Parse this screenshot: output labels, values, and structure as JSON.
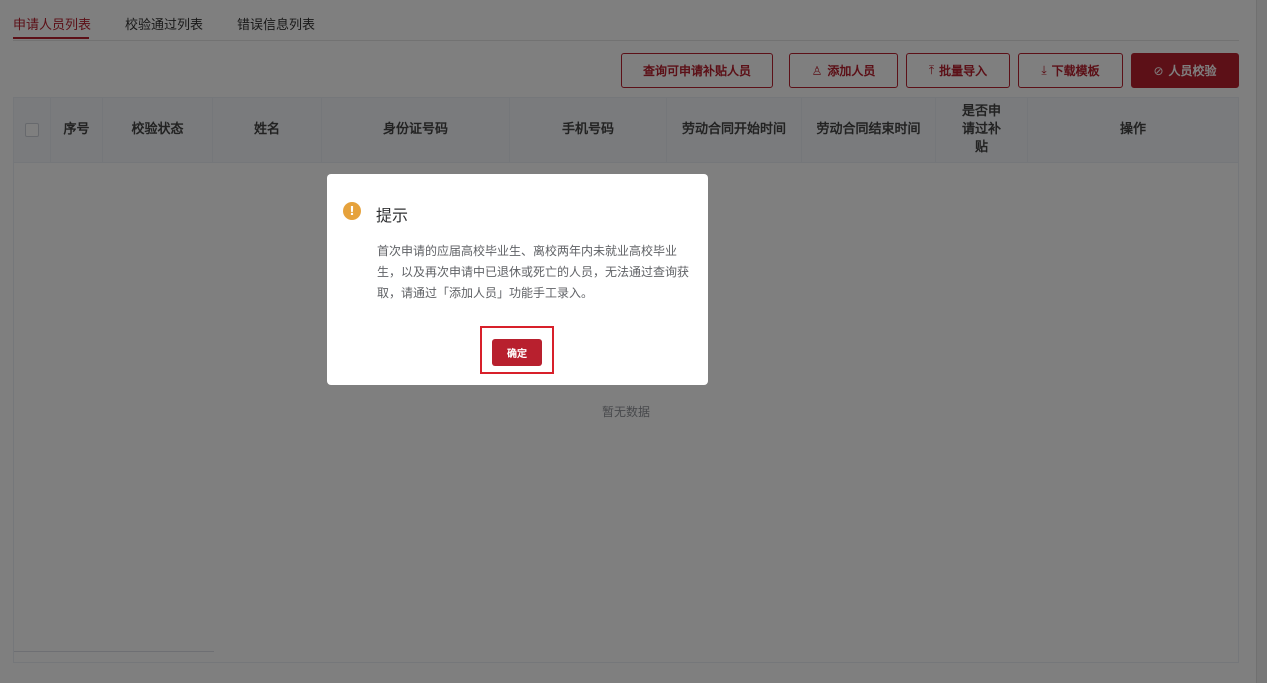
{
  "tabs": [
    {
      "label": "申请人员列表",
      "active": true
    },
    {
      "label": "校验通过列表",
      "active": false
    },
    {
      "label": "错误信息列表",
      "active": false
    }
  ],
  "toolbar": {
    "query_label": "查询可申请补贴人员",
    "add_label": "添加人员",
    "add_icon": "user-icon",
    "import_label": "批量导入",
    "import_icon": "upload-icon",
    "download_label": "下载模板",
    "download_icon": "download-icon",
    "verify_label": "人员校验",
    "verify_icon": "check-circle-icon"
  },
  "table": {
    "columns": [
      "序号",
      "校验状态",
      "姓名",
      "身份证号码",
      "手机号码",
      "劳动合同开始时间",
      "劳动合同结束时间",
      "是否申请过补贴",
      "操作"
    ],
    "empty_text": "暂无数据"
  },
  "dialog": {
    "title": "提示",
    "message": "首次申请的应届高校毕业生、离校两年内未就业高校毕业生，以及再次申请中已退休或死亡的人员，无法通过查询获取，请通过「添加人员」功能手工录入。",
    "confirm_label": "确定",
    "icon": "warning-icon"
  },
  "colors": {
    "accent": "#b8202e",
    "warning": "#e6a23c",
    "highlight": "#d8202a"
  }
}
